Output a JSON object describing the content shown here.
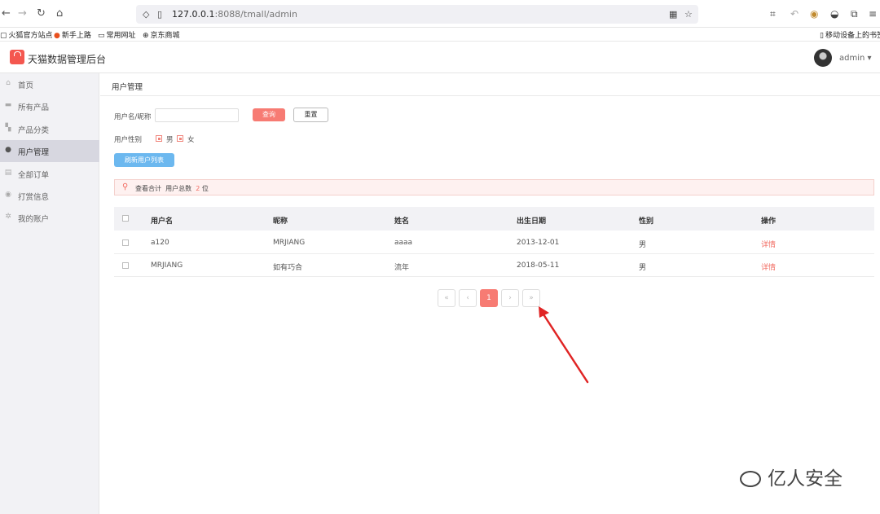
{
  "browser": {
    "url_host": "127.0.0.1",
    "url_rest": ":8088/tmall/admin",
    "bookmarks": [
      "火狐官方站点",
      "新手上路",
      "常用网址",
      "京东商城"
    ],
    "bookmark_right": "移动设备上的书签"
  },
  "header": {
    "title": "天猫数据管理后台",
    "user": "admin"
  },
  "sidebar": {
    "items": [
      {
        "label": "首页",
        "icon": "home-icon"
      },
      {
        "label": "所有产品",
        "icon": "product-icon"
      },
      {
        "label": "产品分类",
        "icon": "grid-icon"
      },
      {
        "label": "用户管理",
        "icon": "user-icon"
      },
      {
        "label": "全部订单",
        "icon": "order-icon"
      },
      {
        "label": "打赏信息",
        "icon": "reward-icon"
      },
      {
        "label": "我的账户",
        "icon": "gear-icon"
      }
    ],
    "active_index": 3
  },
  "page": {
    "breadcrumb": "用户管理",
    "search_label": "用户名/昵称",
    "query_button": "查询",
    "reset_button": "重置",
    "gender_label": "用户性别",
    "gender_options": [
      "男",
      "女"
    ],
    "refresh_button": "刷新用户列表",
    "summary_prefix": "查看合计",
    "summary_label": "用户总数",
    "summary_count": "2",
    "summary_unit": "位"
  },
  "table": {
    "headers": [
      "用户名",
      "昵称",
      "姓名",
      "出生日期",
      "性别",
      "操作"
    ],
    "rows": [
      {
        "username": "a120",
        "nickname": "MRJIANG",
        "name": "aaaa",
        "birthday": "2013-12-01",
        "gender": "男",
        "action": "详情"
      },
      {
        "username": "MRJIANG",
        "nickname": "如有巧合",
        "name": "流年",
        "birthday": "2018-05-11",
        "gender": "男",
        "action": "详情"
      }
    ]
  },
  "pagination": {
    "first": "«",
    "prev": "‹",
    "current": "1",
    "next": "›",
    "last": "»"
  },
  "watermark": "亿人安全",
  "colors": {
    "accent": "#f77b73",
    "refresh": "#6cb8ef",
    "arrow": "#e02424"
  }
}
